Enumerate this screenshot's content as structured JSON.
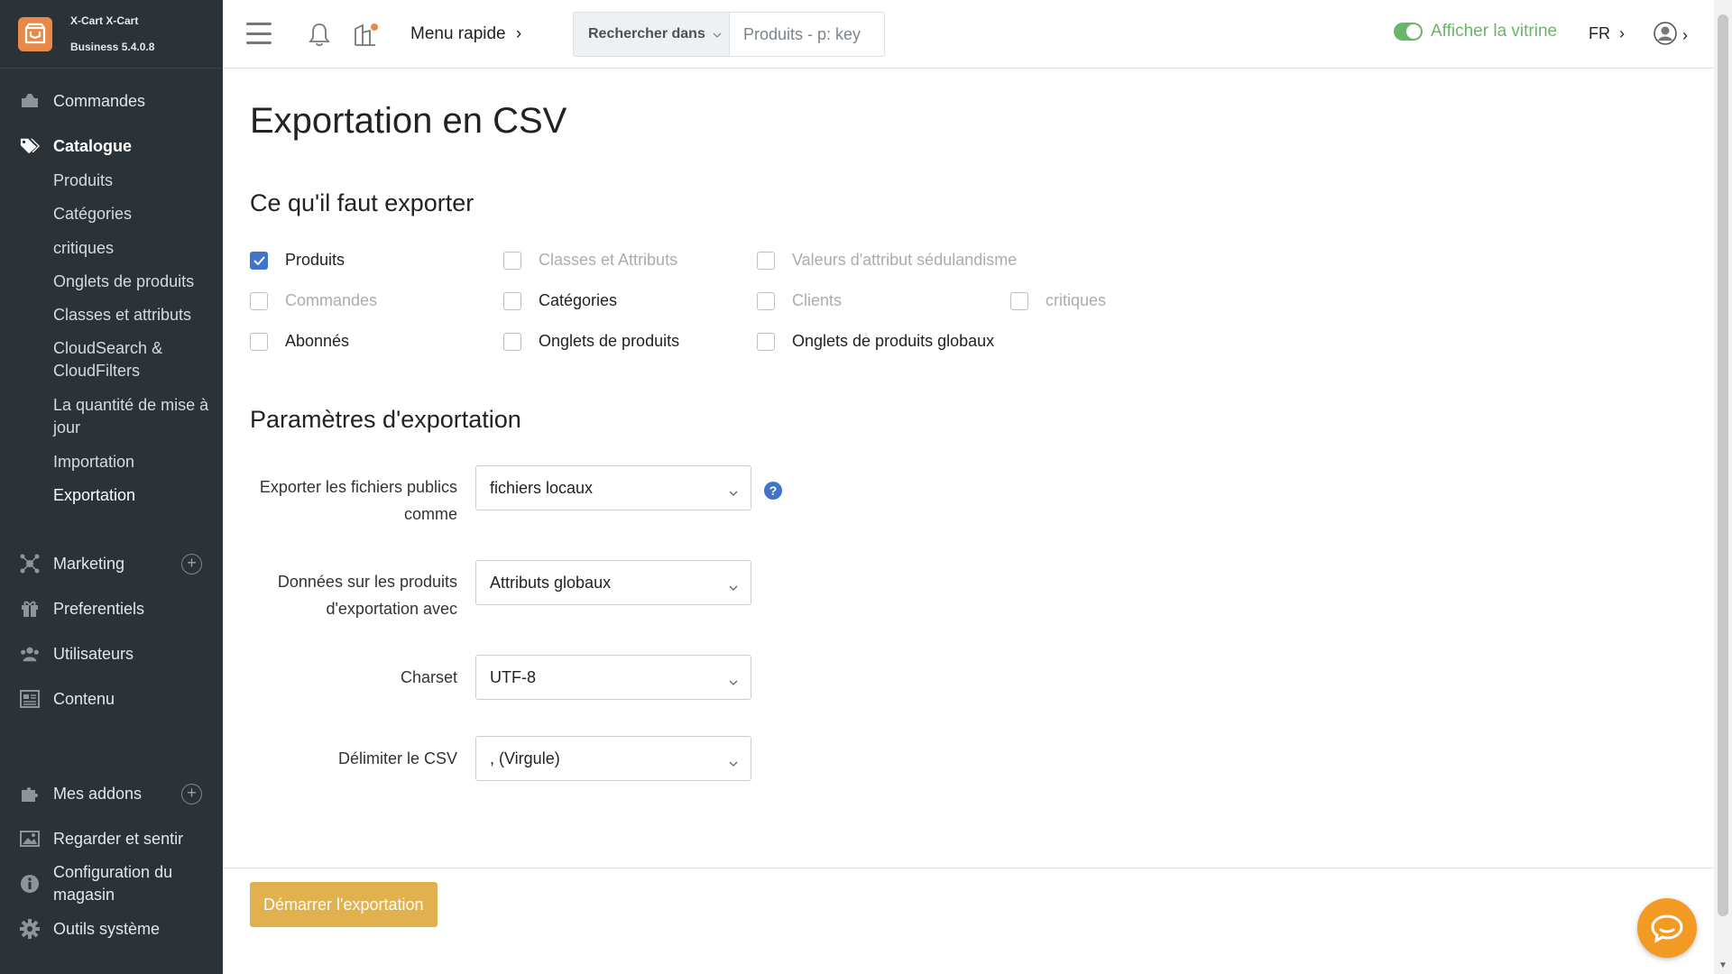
{
  "colors": {
    "sidebar_bg": "#2c3338",
    "accent_blue": "#3f74c9",
    "storefront_green": "#6bb56a",
    "brand_orange": "#e8894a",
    "start_button": "#e1b04f",
    "chat_orange": "#f29a23"
  },
  "brand": {
    "line1": "X-Cart X-Cart",
    "line2": "Business 5.4.0.8",
    "icon": "store-logo-icon"
  },
  "sidebar": {
    "commandes": "Commandes",
    "catalogue": "Catalogue",
    "catalogue_sub": [
      "Produits",
      "Catégories",
      "critiques",
      "Onglets de produits",
      "Classes et attributs",
      "CloudSearch & CloudFilters",
      "La quantité de mise à jour",
      "Importation",
      "Exportation"
    ],
    "marketing": "Marketing",
    "preferentiels": "Preferentiels",
    "utilisateurs": "Utilisateurs",
    "contenu": "Contenu",
    "addons": "Mes addons",
    "look": "Regarder et sentir",
    "config": "Configuration du magasin",
    "tools": "Outils système",
    "plus": "+"
  },
  "header": {
    "quick_menu": "Menu rapide",
    "chevron": "›",
    "search_scope": "Rechercher dans",
    "search_placeholder": "Produits - p: key",
    "storefront": "Afficher la vitrine",
    "lang": "FR"
  },
  "page": {
    "title": "Exportation en CSV",
    "what_title": "Ce qu'il faut exporter",
    "checkboxes": [
      {
        "label": "Produits",
        "checked": true
      },
      {
        "label": "Classes et Attributs",
        "checked": false
      },
      {
        "label": "Valeurs d'attribut sédulandisme",
        "checked": false
      },
      {
        "label": "Commandes",
        "checked": false
      },
      {
        "label": "Catégories",
        "checked": false
      },
      {
        "label": "Clients",
        "checked": false
      },
      {
        "label": "critiques",
        "checked": false
      },
      {
        "label": "Abonnés",
        "checked": false
      },
      {
        "label": "Onglets de produits",
        "checked": false
      },
      {
        "label": "Onglets de produits globaux",
        "checked": false
      }
    ],
    "params_title": "Paramètres d'exportation",
    "fields": {
      "files_label": "Exporter les fichiers publics comme",
      "files_value": "fichiers locaux",
      "data_label": "Données sur les produits d'exportation avec",
      "data_value": "Attributs globaux",
      "charset_label": "Charset",
      "charset_value": "UTF-8",
      "delim_label": "Délimiter le CSV",
      "delim_value": ", (Virgule)"
    },
    "help": "?",
    "start_button": "Démarrer l'exportation"
  }
}
